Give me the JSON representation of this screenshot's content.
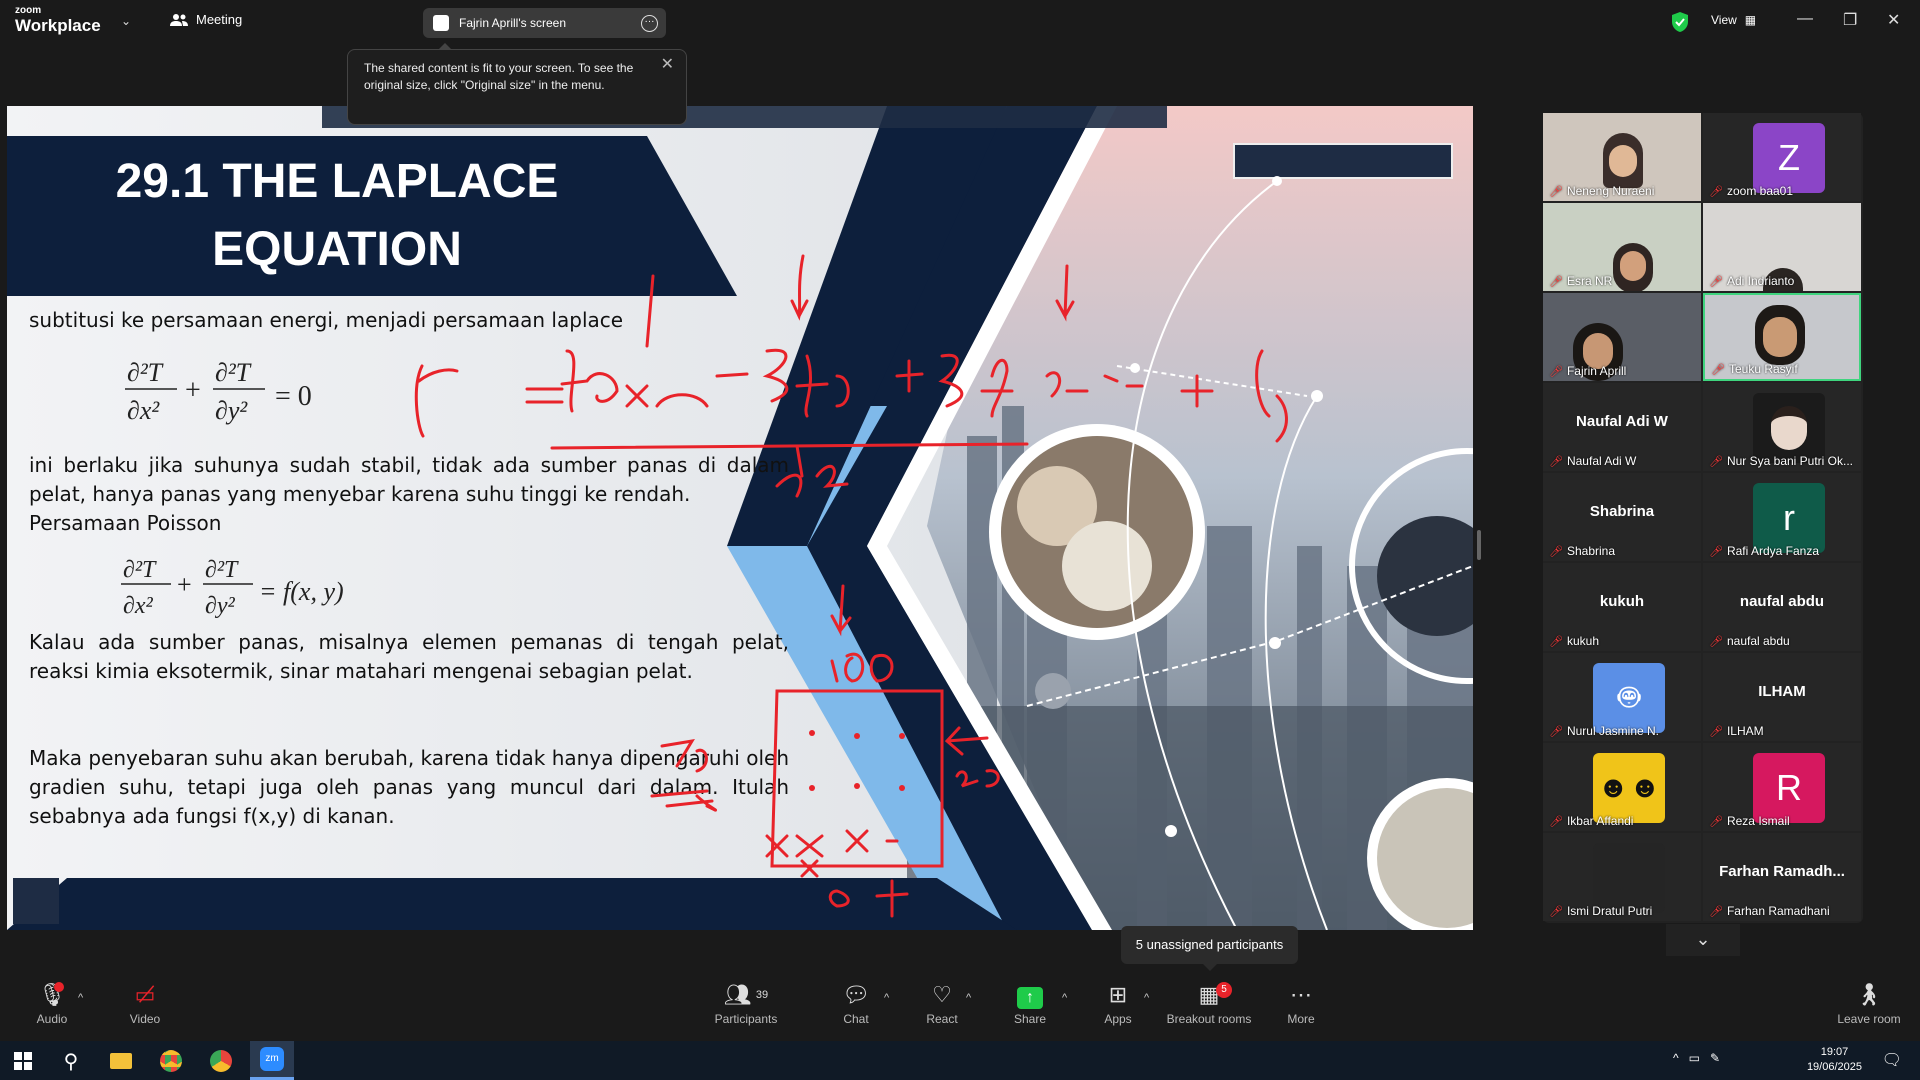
{
  "topbar": {
    "logo_small": "zoom",
    "logo_big": "Workplace",
    "meeting_label": "Meeting",
    "screen_label": "Fajrin Aprill's screen",
    "view_label": "View"
  },
  "tooltip": {
    "text": "The shared content is fit to your screen. To see the original size, click \"Original size\" in the menu."
  },
  "slide": {
    "title_line1": "29.1 THE LAPLACE",
    "title_line2": "EQUATION",
    "p1": "subtitusi ke persamaan energi, menjadi persamaan laplace",
    "p2": "ini berlaku jika suhunya sudah stabil, tidak ada sumber panas di dalam pelat, hanya panas yang menyebar karena suhu tinggi ke rendah.",
    "p3": "Persamaan Poisson",
    "p4": "Kalau ada sumber panas, misalnya elemen pemanas di tengah pelat, reaksi kimia eksotermik, sinar matahari mengenai sebagian pelat.",
    "p5": "Maka penyebaran suhu akan berubah, karena tidak hanya dipengaruhi oleh gradien suhu, tetapi juga oleh panas yang muncul dari dalam. Itulah sebabnya ada fungsi f(x,y) di kanan.",
    "eq1_rhs": "= 0",
    "eq2_rhs": "= f(x, y)",
    "annotation_100": "100",
    "annotation_75": "75",
    "annotation_50": "50",
    "annotation_0": "0",
    "annotation_h2": "h²"
  },
  "gallery": {
    "tiles": [
      {
        "name": "Neneng Nuraeni"
      },
      {
        "name": "zoom baa01",
        "initial": "Z"
      },
      {
        "name": "Esra NR"
      },
      {
        "name": "Adi Indrianto"
      },
      {
        "name": "Fajrin Aprill"
      },
      {
        "name": "Teuku Rasyif"
      },
      {
        "name": "Naufal Adi W",
        "center": "Naufal Adi W"
      },
      {
        "name": "Nur Sya bani Putri Ok..."
      },
      {
        "name": "Shabrina",
        "center": "Shabrina"
      },
      {
        "name": "Rafi Ardya Fanza",
        "initial": "r"
      },
      {
        "name": "kukuh",
        "center": "kukuh"
      },
      {
        "name": "naufal abdu",
        "center": "naufal abdu"
      },
      {
        "name": "Nurul Jasmine N."
      },
      {
        "name": "ILHAM",
        "center": "ILHAM"
      },
      {
        "name": "Ikbar Affandi"
      },
      {
        "name": "Reza Ismail",
        "initial": "R"
      },
      {
        "name": "Ismi Dratul Putri"
      },
      {
        "name": "Farhan Ramadhani",
        "center": "Farhan Ramadh..."
      }
    ],
    "unassigned": "5 unassigned participants"
  },
  "bottombar": {
    "audio": "Audio",
    "video": "Video",
    "participants": "Participants",
    "participants_count": "39",
    "chat": "Chat",
    "react": "React",
    "share": "Share",
    "apps": "Apps",
    "breakout": "Breakout rooms",
    "breakout_badge": "5",
    "more": "More",
    "leave": "Leave room"
  },
  "taskbar": {
    "time": "19:07",
    "date": "19/06/2025"
  },
  "colors": {
    "navy": "#0d1f3c",
    "light_blue": "#7fb9ea",
    "pen_red": "#e8232a",
    "share_green": "#1fcb4a",
    "active_border": "#3fd47e"
  }
}
